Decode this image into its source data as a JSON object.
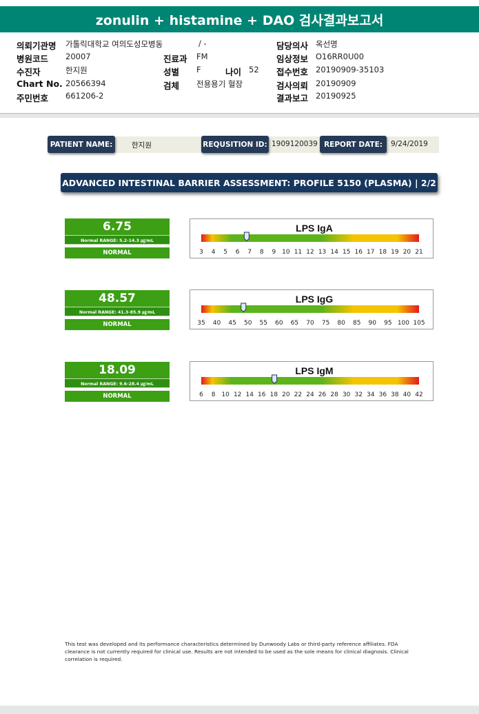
{
  "report_title": "zonulin + histamine + DAO 검사결과보고서",
  "info": {
    "institution_label": "의뢰기관명",
    "institution_value": "가톨릭대학교 여의도성모병동",
    "ward_value": "/ -",
    "doctor_label": "담당의사",
    "doctor_value": "옥선명",
    "hospital_code_label": "병원코드",
    "hospital_code_value": "20007",
    "department_label": "진료과",
    "department_value": "FM",
    "clinical_info_label": "임상정보",
    "clinical_info_value": "O16RR0U00",
    "patient_label": "수진자",
    "patient_value": "한지원",
    "sex_label": "성별",
    "sex_value": "F",
    "age_label": "나이",
    "age_value": "52",
    "receipt_label": "접수번호",
    "receipt_value": "20190909-35103",
    "chart_label": "Chart No.",
    "chart_value": "20566394",
    "specimen_label": "검체",
    "specimen_value": "전용용기 혈장",
    "request_label": "검사의뢰",
    "request_value": "20190909",
    "id_label": "주민번호",
    "id_value": "661206-2",
    "report_label": "결과보고",
    "report_value": "20190925"
  },
  "patient_strip": {
    "name_label": "PATIENT NAME:",
    "name_value": "한지원",
    "req_label": "REQUSITION ID:",
    "req_value": "1909120039",
    "date_label": "REPORT DATE:",
    "date_value": "9/24/2019"
  },
  "assessment_title": "ADVANCED INTESTINAL BARRIER ASSESSMENT: PROFILE 5150 (PLASMA) | 2/2",
  "results": [
    {
      "value": "6.75",
      "range": "Normal RANGE: 5.2-14.3 ㎍/mL",
      "status": "NORMAL"
    },
    {
      "value": "48.57",
      "range": "Normal RANGE: 41.3-85.9 ㎍/mL",
      "status": "NORMAL"
    },
    {
      "value": "18.09",
      "range": "Normal RANGE: 9.6-28.4 ㎍/mL",
      "status": "NORMAL"
    }
  ],
  "chart_data": [
    {
      "type": "gauge",
      "title": "LPS IgA",
      "marker": 6.75,
      "normal_range": [
        5.2,
        14.3
      ],
      "ticks": [
        3,
        4,
        5,
        6,
        7,
        8,
        9,
        10,
        11,
        12,
        13,
        14,
        15,
        16,
        17,
        18,
        19,
        20,
        21
      ],
      "xlim": [
        3,
        21
      ]
    },
    {
      "type": "gauge",
      "title": "LPS IgG",
      "marker": 48.57,
      "normal_range": [
        41.3,
        85.9
      ],
      "ticks": [
        35,
        40,
        45,
        50,
        55,
        60,
        65,
        70,
        75,
        80,
        85,
        90,
        95,
        100,
        105
      ],
      "xlim": [
        35,
        105
      ]
    },
    {
      "type": "gauge",
      "title": "LPS IgM",
      "marker": 18.09,
      "normal_range": [
        9.6,
        28.4
      ],
      "ticks": [
        6,
        8,
        10,
        12,
        14,
        16,
        18,
        20,
        22,
        24,
        26,
        28,
        30,
        32,
        34,
        36,
        38,
        40,
        42
      ],
      "xlim": [
        6,
        42
      ]
    }
  ],
  "colors": {
    "header": "#008574",
    "normal_green": "#3c9f14",
    "navy": "#17375e"
  },
  "footer_text": "This test was developed and its performance characteristics determined by Dunwoody Labs or third-party reference affiliates. FDA clearance is not currently required for clinical use. Results are not intended to be used as the sole means for clinical diagnosis. Clinical correlation is required."
}
